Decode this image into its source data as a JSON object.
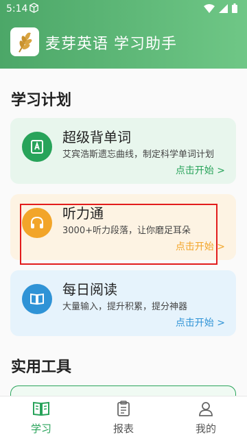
{
  "status_bar": {
    "time": "5:14"
  },
  "header": {
    "app_title": "麦芽英语 学习助手"
  },
  "sections": {
    "plan_title": "学习计划",
    "tools_title": "实用工具"
  },
  "cards": [
    {
      "title": "超级背单词",
      "desc": "艾宾浩斯遗忘曲线，制定科学单词计划",
      "action": "点击开始 >",
      "icon": "book-a-icon",
      "accent": "#28a35a",
      "bg": "#e8f6ed"
    },
    {
      "title": "听力通",
      "desc": "3000+听力段落，让你磨足耳朵",
      "action": "点击开始 >",
      "icon": "headphones-icon",
      "accent": "#f2a52a",
      "bg": "#fdf3e3"
    },
    {
      "title": "每日阅读",
      "desc": "大量输入，提升积累，提分神器",
      "action": "点击开始 >",
      "icon": "open-book-icon",
      "accent": "#2f93d6",
      "bg": "#e6f3fc"
    }
  ],
  "tabs": [
    {
      "label": "学习",
      "icon": "study-book-icon",
      "active": true
    },
    {
      "label": "报表",
      "icon": "clipboard-icon",
      "active": false
    },
    {
      "label": "我的",
      "icon": "user-icon",
      "active": false
    }
  ],
  "colors": {
    "header_start": "#4ca768",
    "header_end": "#6fc786",
    "active_tab": "#28a35a",
    "inactive_tab": "#555555",
    "highlight_box": "#e21b1b"
  }
}
